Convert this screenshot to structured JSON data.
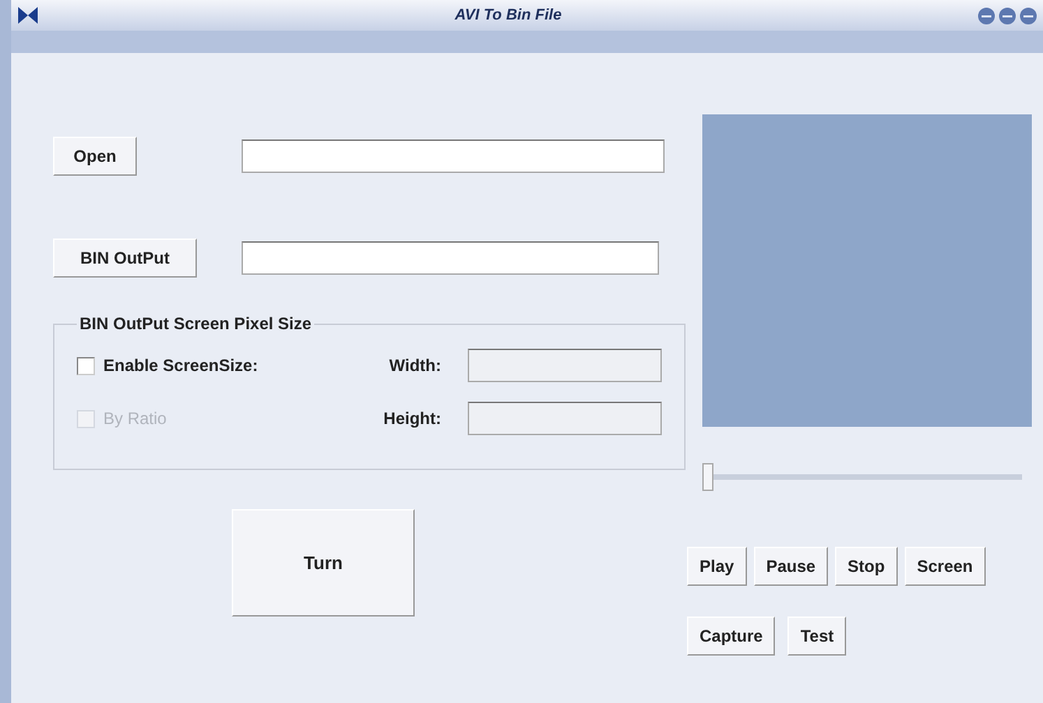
{
  "window": {
    "title": "AVI To Bin File"
  },
  "open": {
    "label": "Open"
  },
  "output": {
    "label": "BIN OutPut"
  },
  "group": {
    "title": "BIN OutPut Screen Pixel Size",
    "enable": {
      "label": "Enable ScreenSize:",
      "checked": false,
      "disabled": false
    },
    "ratio": {
      "label": "By Ratio",
      "checked": false,
      "disabled": true
    },
    "width": {
      "label": "Width:"
    },
    "height": {
      "label": "Height:"
    }
  },
  "turn": {
    "label": "Turn"
  },
  "slider": {
    "level": 0
  },
  "player_buttons": [
    "Play",
    "Pause",
    "Stop",
    "Screen"
  ],
  "extra_buttons": [
    "Capture",
    "Test"
  ]
}
